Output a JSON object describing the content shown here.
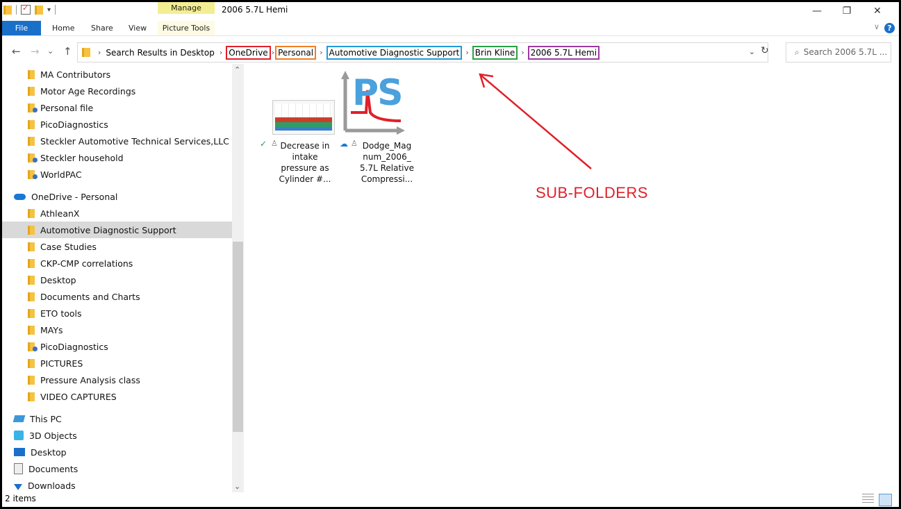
{
  "window": {
    "title": "2006 5.7L Hemi",
    "manage_label": "Manage",
    "controls": {
      "minimize": "—",
      "maximize": "❐",
      "close": "✕"
    }
  },
  "ribbon": {
    "tabs": {
      "file": "File",
      "home": "Home",
      "share": "Share",
      "view": "View",
      "picture_tools": "Picture Tools"
    },
    "help": "?",
    "collapse": "∨"
  },
  "address": {
    "back": "←",
    "forward": "→",
    "recent": "⌄",
    "up": "↑",
    "crumbs": [
      {
        "label": "Search Results in Desktop",
        "color": ""
      },
      {
        "label": "OneDrive",
        "color": "#e0202a"
      },
      {
        "label": "Personal",
        "color": "#f07e24"
      },
      {
        "label": "Automotive Diagnostic Support",
        "color": "#1e9ad6"
      },
      {
        "label": "Brin Kline",
        "color": "#27a245"
      },
      {
        "label": "2006 5.7L Hemi",
        "color": "#9b3aa2"
      }
    ],
    "separator": "›",
    "dropdown": "⌄",
    "refresh": "↻",
    "search_placeholder": "Search 2006 5.7L ..."
  },
  "nav": {
    "items": [
      {
        "label": "MA Contributors",
        "icon": "folder-icon"
      },
      {
        "label": "Motor Age Recordings",
        "icon": "folder-icon"
      },
      {
        "label": "Personal file",
        "icon": "shared-folder-icon"
      },
      {
        "label": "PicoDiagnostics",
        "icon": "folder-icon"
      },
      {
        "label": "Steckler Automotive Technical Services,LLC",
        "icon": "folder-icon"
      },
      {
        "label": "Steckler household",
        "icon": "shared-folder-icon"
      },
      {
        "label": "WorldPAC",
        "icon": "shared-folder-icon"
      },
      {
        "label": "OneDrive - Personal",
        "icon": "onedrive-cloud-icon"
      },
      {
        "label": "AthleanX",
        "icon": "folder-icon"
      },
      {
        "label": "Automotive Diagnostic Support",
        "icon": "folder-icon",
        "selected": true
      },
      {
        "label": "Case Studies",
        "icon": "folder-icon"
      },
      {
        "label": "CKP-CMP correlations",
        "icon": "folder-icon"
      },
      {
        "label": "Desktop",
        "icon": "folder-icon"
      },
      {
        "label": "Documents and Charts",
        "icon": "folder-icon"
      },
      {
        "label": "ETO tools",
        "icon": "folder-icon"
      },
      {
        "label": "MAYs",
        "icon": "folder-icon"
      },
      {
        "label": "PicoDiagnostics",
        "icon": "shared-folder-icon"
      },
      {
        "label": "PICTURES",
        "icon": "folder-icon"
      },
      {
        "label": "Pressure Analysis class",
        "icon": "folder-icon"
      },
      {
        "label": "VIDEO CAPTURES",
        "icon": "folder-icon"
      },
      {
        "label": "This PC",
        "icon": "this-pc-icon"
      },
      {
        "label": "3D Objects",
        "icon": "3d-objects-icon"
      },
      {
        "label": "Desktop",
        "icon": "desktop-icon"
      },
      {
        "label": "Documents",
        "icon": "documents-icon"
      },
      {
        "label": "Downloads",
        "icon": "downloads-icon"
      }
    ],
    "scroll_up": "⌃",
    "scroll_down": "⌄"
  },
  "files": [
    {
      "name_lines": [
        "Decrease in",
        "intake",
        "pressure as",
        "Cylinder #..."
      ],
      "status": "synced",
      "status_glyph": "✓"
    },
    {
      "name_lines": [
        "Dodge_Mag",
        "num_2006_",
        "5.7L Relative",
        "Compressi..."
      ],
      "status": "cloud",
      "status_glyph": "☁",
      "logo_text": "PS"
    }
  ],
  "annotation": {
    "text": "SUB-FOLDERS",
    "color": "#e0202a"
  },
  "status_bar": {
    "item_count": "2 items"
  }
}
